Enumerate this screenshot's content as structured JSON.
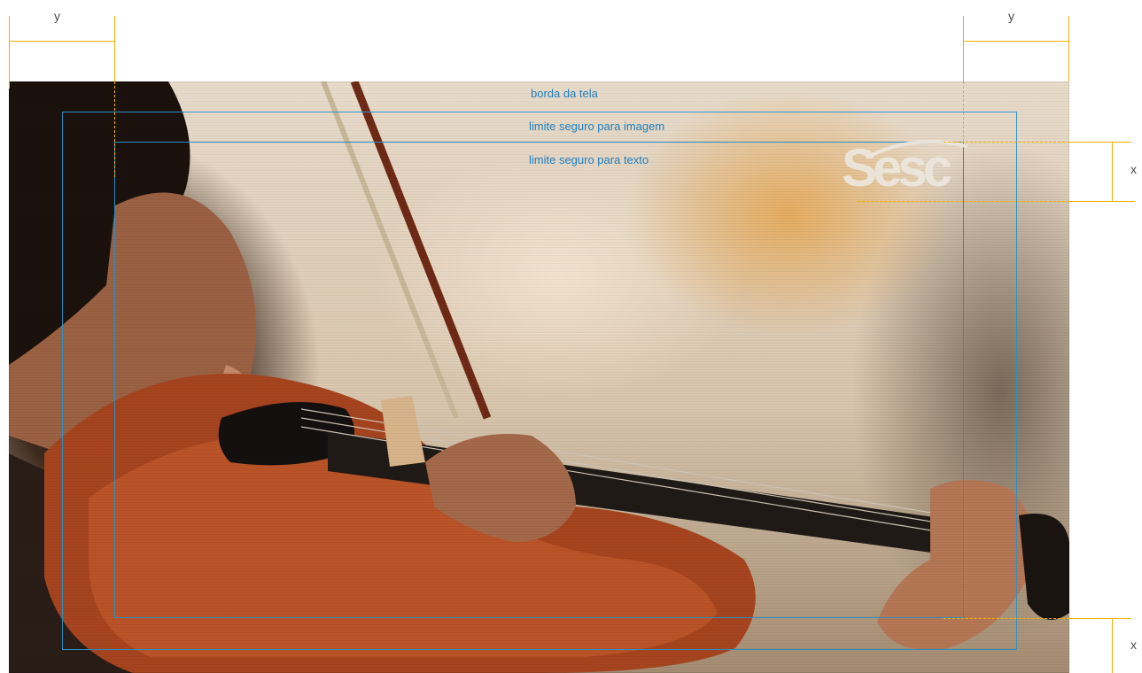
{
  "labels": {
    "screen_edge": "borda da tela",
    "image_safe": "limite seguro para imagem",
    "text_safe": "limite seguro para texto"
  },
  "dimensions": {
    "left_margin": "y",
    "right_margin": "y",
    "top_offset": "x",
    "bottom_offset": "x"
  },
  "logo": {
    "text": "Sesc"
  },
  "colors": {
    "frame_lines": "#2a8fc6",
    "label_text": "#1f7fbf",
    "guide_lines": "#f2b100",
    "logo": "#ece6de"
  }
}
